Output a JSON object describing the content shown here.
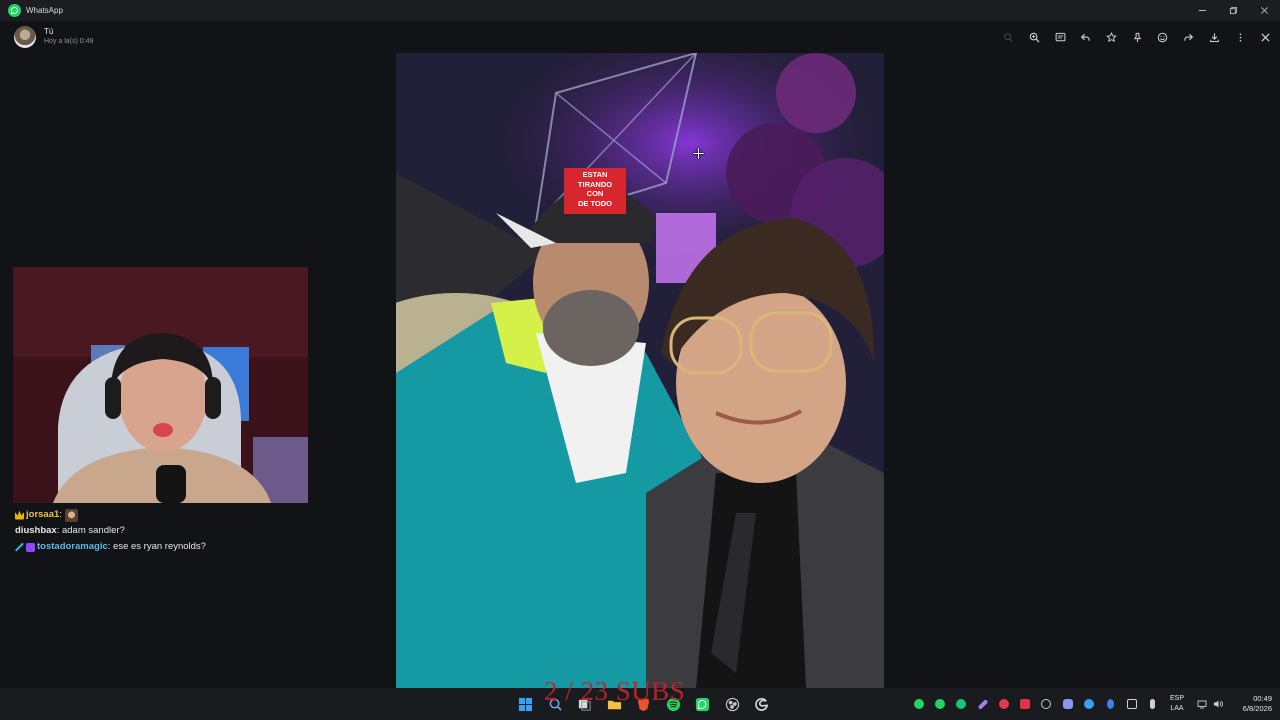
{
  "window": {
    "title": "WhatsApp"
  },
  "viewer": {
    "sender_name": "Tú",
    "sender_time": "Hoy a la(s) 0:49",
    "tools": [
      "search-icon",
      "zoom-in-icon",
      "caption-icon",
      "reply-icon",
      "star-icon",
      "pin-icon",
      "emoji-icon",
      "forward-icon",
      "download-icon",
      "more-icon",
      "close-icon"
    ]
  },
  "photo": {
    "cap_text": [
      "ESTAN",
      "TIRANDO",
      "CON",
      "DE TODO"
    ]
  },
  "chat": {
    "messages": [
      {
        "user": "jorsaa1",
        "sep": ":",
        "text": "",
        "user_color": "#e8c24a",
        "badge_color": "#e8b400"
      },
      {
        "user": "diushbax",
        "sep": ":",
        "text": " adam sandler?",
        "user_color": "#e6e6e6"
      },
      {
        "user": "tostadoramagic",
        "sep": ":",
        "text": " ese es ryan reynolds?",
        "user_color": "#5fb8e8",
        "badge_color": "#9147ff"
      }
    ]
  },
  "overlay": {
    "subs_text": "2 / 23 SUBS"
  },
  "taskbar": {
    "apps": [
      {
        "name": "windows-start-icon",
        "color": "#3aa0f5"
      },
      {
        "name": "search-taskbar-icon",
        "color": "#6fa8e8"
      },
      {
        "name": "task-view-icon",
        "color": "#d8d8d8"
      },
      {
        "name": "file-explorer-icon",
        "color": "#f3c03a"
      },
      {
        "name": "brave-icon",
        "color": "#e8532a"
      },
      {
        "name": "spotify-icon",
        "color": "#1ed760"
      },
      {
        "name": "whatsapp-taskbar-icon",
        "color": "#25d366"
      },
      {
        "name": "obs-icon",
        "color": "#c8c8c8"
      },
      {
        "name": "edge-icon",
        "color": "#cfd8dc"
      }
    ],
    "tray": [
      {
        "name": "spotify-tray-icon",
        "color": "#1ed760"
      },
      {
        "name": "whatsapp-tray-icon",
        "color": "#25d366"
      },
      {
        "name": "chatgpt-tray-icon",
        "color": "#19c37d"
      },
      {
        "name": "pen-tray-icon",
        "color": "#a97cf0"
      },
      {
        "name": "red-dot-tray-icon",
        "color": "#e23b4a"
      },
      {
        "name": "square-red-tray-icon",
        "color": "#e2324a"
      },
      {
        "name": "steam-like-tray-icon",
        "color": "#c9c9c9"
      },
      {
        "name": "discord-tray-icon",
        "color": "#8a95f2"
      },
      {
        "name": "sync-tray-icon",
        "color": "#3b9ef0"
      },
      {
        "name": "bluetooth-tray-icon",
        "color": "#3b82f0"
      },
      {
        "name": "volume-small-tray-icon",
        "color": "#d0d0d0"
      },
      {
        "name": "mic-tray-icon",
        "color": "#d0d0d0"
      }
    ],
    "lang_primary": "ESP",
    "lang_secondary": "LAA",
    "time": "00:49",
    "date": "6/8/2026"
  }
}
